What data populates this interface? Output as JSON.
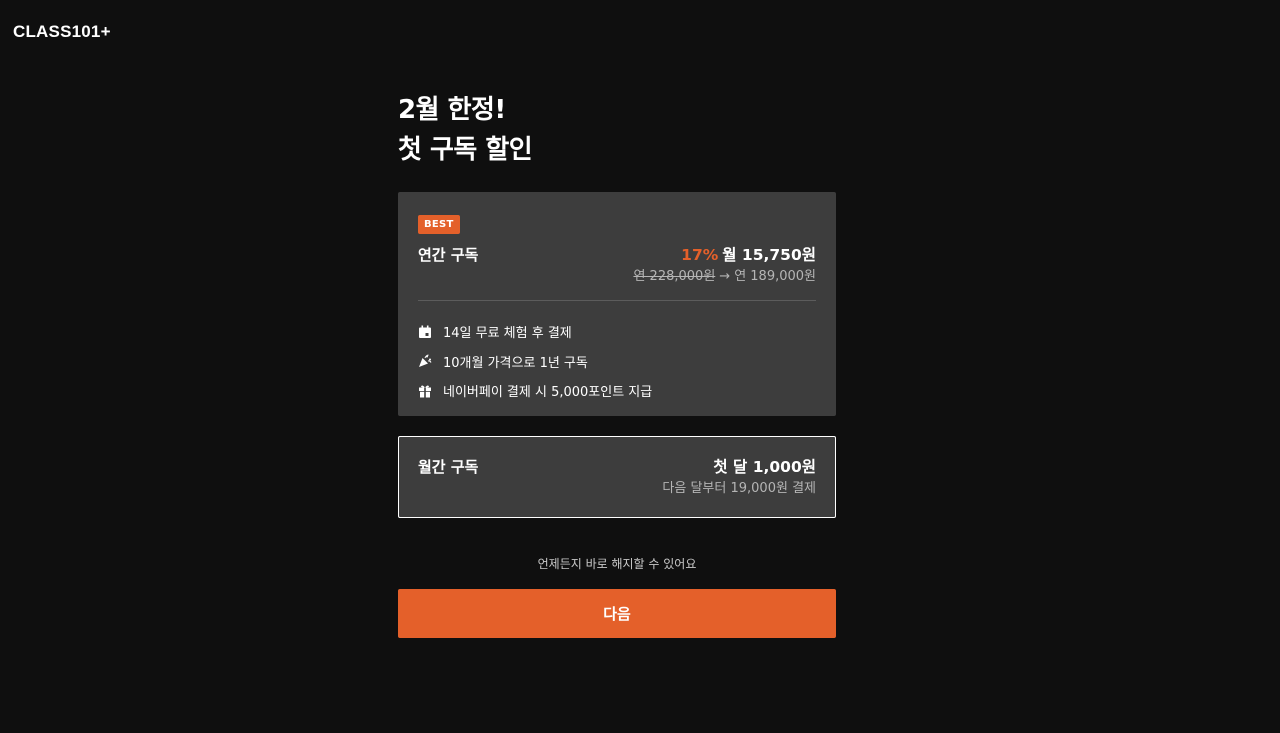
{
  "brand": {
    "logo": "CLASS101+"
  },
  "headline": {
    "line1": "2월 한정!",
    "line2": "첫 구독 할인"
  },
  "annual_plan": {
    "badge": "BEST",
    "name": "연간 구독",
    "discount": "17%",
    "price": "월 15,750원",
    "original_price": "연 228,000원",
    "arrow": "→",
    "final_price": "연 189,000원",
    "features": [
      {
        "icon": "calendar-icon",
        "text": "14일 무료 체험 후 결제"
      },
      {
        "icon": "party-popper-icon",
        "text": "10개월 가격으로 1년 구독"
      },
      {
        "icon": "gift-icon",
        "text": "네이버페이 결제 시 5,000포인트 지급"
      }
    ]
  },
  "monthly_plan": {
    "name": "월간 구독",
    "price": "첫 달 1,000원",
    "sub": "다음 달부터 19,000원 결제"
  },
  "note": "언제든지 바로 해지할 수 있어요",
  "next_button": "다음",
  "colors": {
    "accent": "#e4602a",
    "background": "#0f0f0f",
    "card": "#3d3d3d"
  }
}
